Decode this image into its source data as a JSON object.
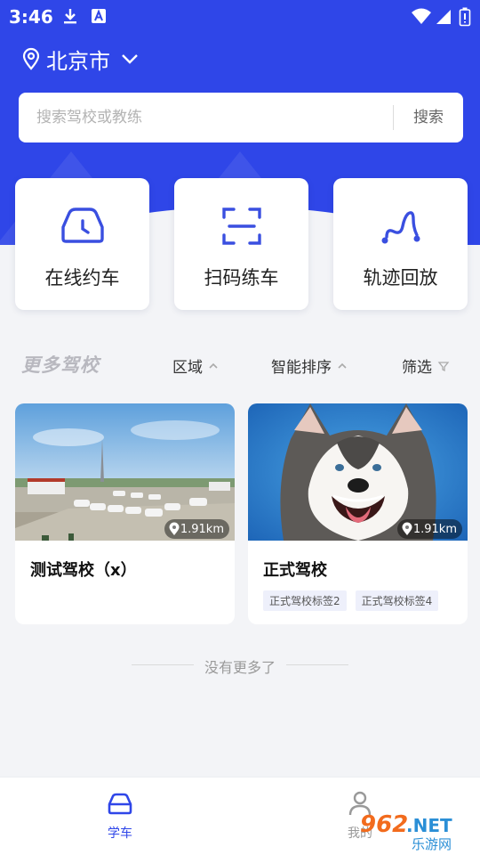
{
  "status_bar": {
    "time": "3:46"
  },
  "location": {
    "city": "北京市"
  },
  "search": {
    "placeholder": "搜索驾校或教练",
    "button": "搜索"
  },
  "quick_actions": [
    {
      "label": "在线约车",
      "icon": "car-clock-icon"
    },
    {
      "label": "扫码练车",
      "icon": "scan-frame-icon"
    },
    {
      "label": "轨迹回放",
      "icon": "track-path-icon"
    }
  ],
  "section": {
    "title": "更多驾校",
    "filters": [
      {
        "label": "区域",
        "icon": "chevron-up-icon"
      },
      {
        "label": "智能排序",
        "icon": "chevron-up-icon"
      },
      {
        "label": "筛选",
        "icon": "filter-icon"
      }
    ]
  },
  "schools": [
    {
      "name": "测试驾校（x）",
      "distance": "1.91km",
      "tags": []
    },
    {
      "name": "正式驾校",
      "distance": "1.91km",
      "tags": [
        "正式驾校标签2",
        "正式驾校标签4"
      ]
    }
  ],
  "list_end_text": "没有更多了",
  "tabbar": {
    "tabs": [
      {
        "label": "学车",
        "active": true
      },
      {
        "label": "我的",
        "active": false
      }
    ]
  },
  "watermark": {
    "text_top": "962.NET",
    "text_bottom": "乐游网"
  },
  "colors": {
    "primary": "#2f46e8",
    "accent_icon": "#3a4fe0",
    "tab_active": "#2f46e8",
    "tab_inactive": "#999999"
  }
}
